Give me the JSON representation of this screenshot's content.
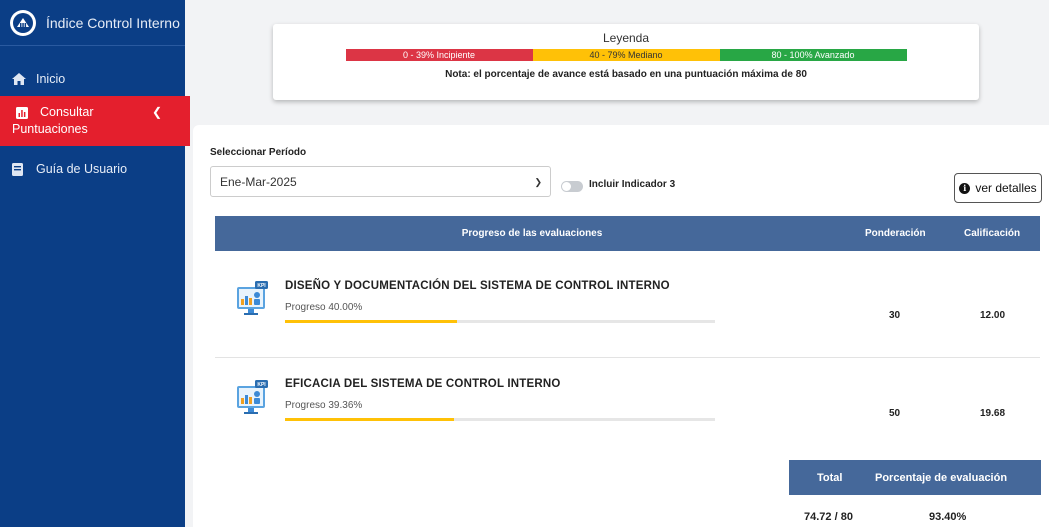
{
  "sidebar": {
    "brand_title": "Índice Control Interno",
    "items": [
      {
        "label": "Inicio",
        "icon": "home-icon"
      },
      {
        "label_line1": "Consultar",
        "label_line2": "Puntuaciones",
        "icon": "bar-chart-icon",
        "active": true
      },
      {
        "label": "Guía de Usuario",
        "icon": "book-icon"
      }
    ],
    "colors": {
      "background": "#0b3e86",
      "active": "#e41f2d"
    }
  },
  "legend": {
    "title": "Leyenda",
    "segments": [
      {
        "label": "0 - 39% Incipiente",
        "color": "#dc3545"
      },
      {
        "label": "40 - 79% Mediano",
        "color": "#ffc107"
      },
      {
        "label": "80 - 100% Avanzado",
        "color": "#28a745"
      }
    ],
    "note": "Nota: el porcentaje de avance está basado en una puntuación máxima de 80"
  },
  "filters": {
    "period_label": "Seleccionar Período",
    "period_value": "Ene-Mar-2025",
    "toggle_label": "Incluir Indicador 3",
    "toggle_on": false,
    "details_button": "ver detalles"
  },
  "table": {
    "headers": {
      "progress": "Progreso de las evaluaciones",
      "ponderacion": "Ponderación",
      "calificacion": "Calificación"
    },
    "rows": [
      {
        "title": "DISEÑO Y DOCUMENTACIÓN DEL SISTEMA DE CONTROL INTERNO",
        "progress_label": "Progreso 40.00%",
        "progress": 0.4,
        "ponderacion": "30",
        "calificacion": "12.00"
      },
      {
        "title": "EFICACIA DEL SISTEMA DE CONTROL INTERNO",
        "progress_label": "Progreso 39.36%",
        "progress": 0.3936,
        "ponderacion": "50",
        "calificacion": "19.68"
      }
    ]
  },
  "totals": {
    "total_header": "Total",
    "percent_header": "Porcentaje de evaluación",
    "total_value": "74.72 / 80",
    "percent_value": "93.40%"
  }
}
